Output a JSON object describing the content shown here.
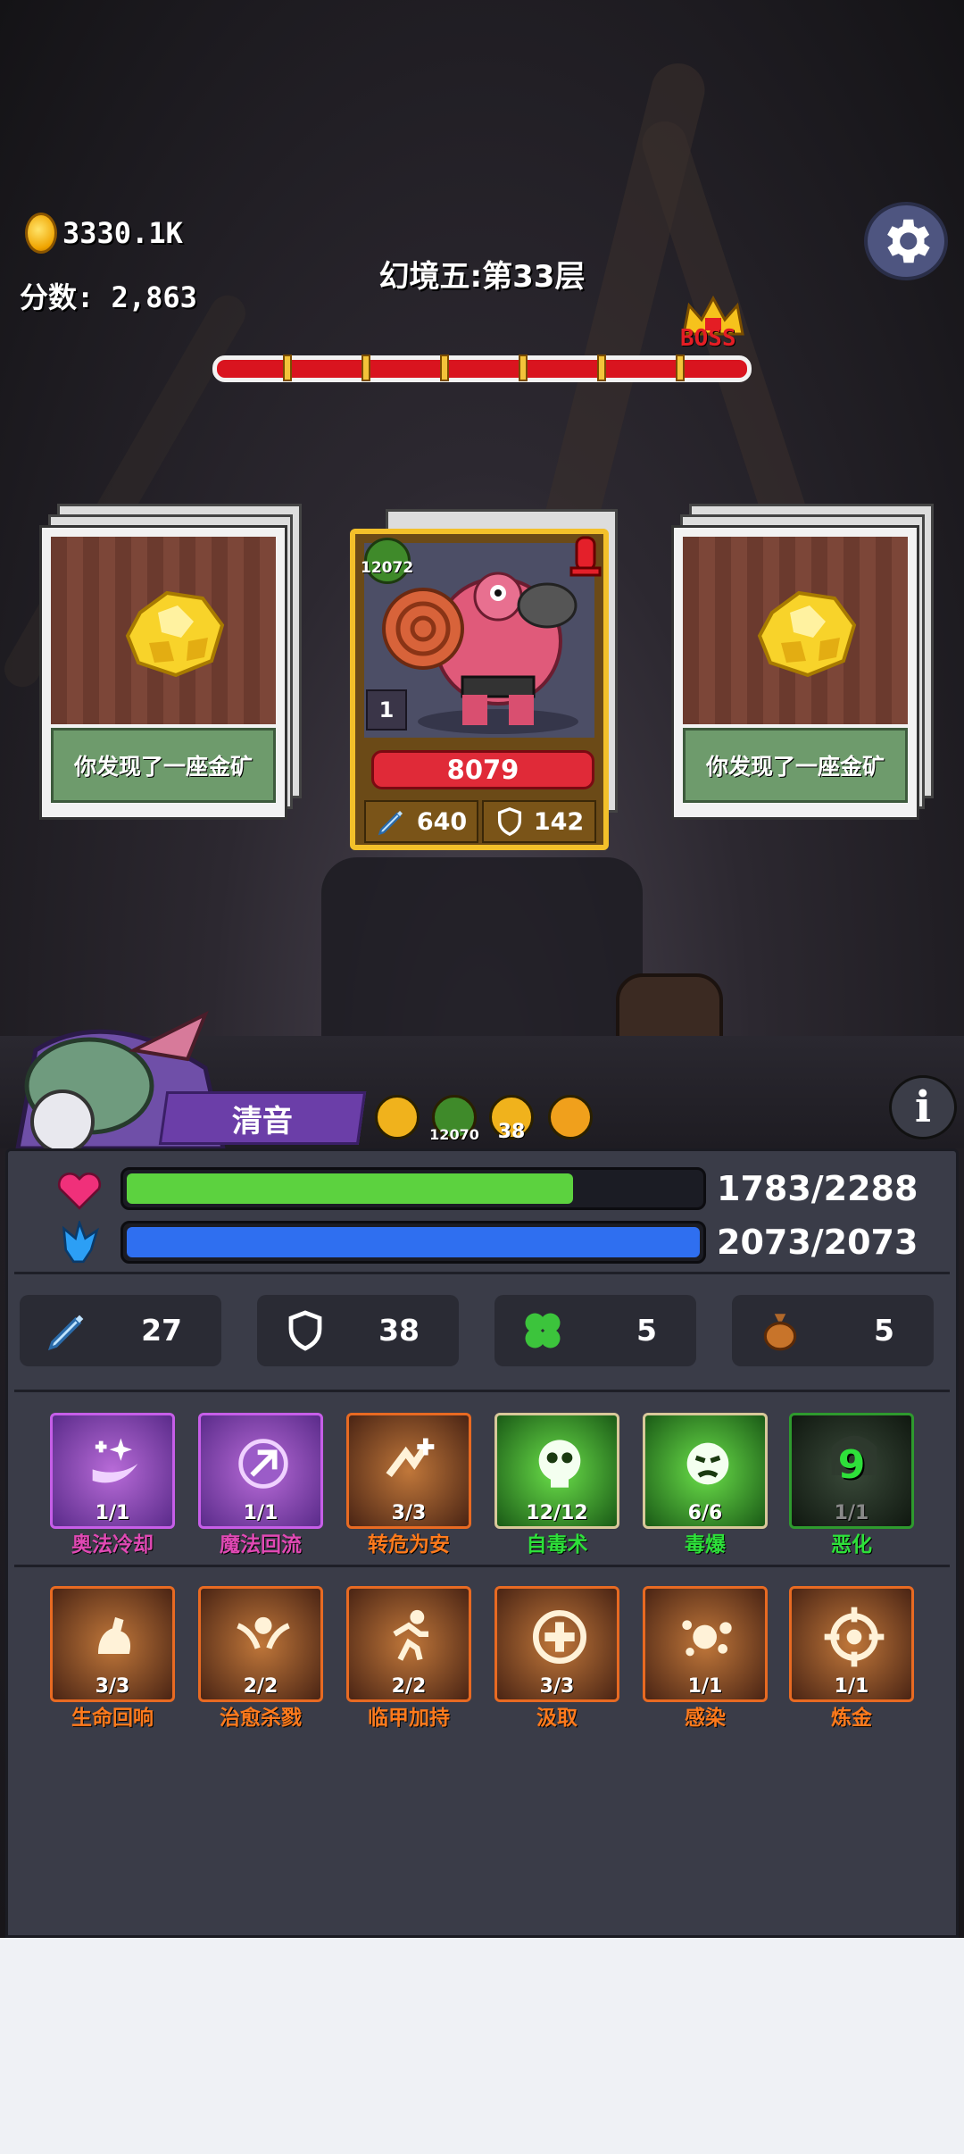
{
  "hud": {
    "coins": "3330.1K",
    "score_label": "分数: 2,863",
    "stage_title": "幻境五:第33层",
    "boss_label": "BOSS"
  },
  "cards": {
    "left": {
      "caption": "你发现了一座金矿"
    },
    "right": {
      "caption": "你发现了一座金矿"
    }
  },
  "enemy": {
    "badge_value": "12072",
    "level": "1",
    "hp": "8079",
    "attack": "640",
    "defense": "142"
  },
  "player": {
    "name": "清音",
    "buffs": [
      {
        "icon": "person-buff-icon",
        "value": ""
      },
      {
        "icon": "poison-buff-icon",
        "value": "12070"
      },
      {
        "icon": "shield-buff-icon",
        "value": "38"
      },
      {
        "icon": "fist-buff-icon",
        "value": ""
      }
    ],
    "hp_text": "1783/2288",
    "hp_fraction": 0.779,
    "mp_text": "2073/2073",
    "mp_fraction": 1.0,
    "stats": {
      "attack": "27",
      "defense": "38",
      "luck": "5",
      "gold_bag": "5"
    }
  },
  "skills_row1": [
    {
      "name": "奥法冷却",
      "level": "1/1",
      "icon": "purple-magic-icon"
    },
    {
      "name": "魔法回流",
      "level": "1/1",
      "icon": "purple-flow-icon"
    },
    {
      "name": "转危为安",
      "level": "3/3",
      "icon": "orange-heal-icon"
    },
    {
      "name": "自毒术",
      "level": "12/12",
      "icon": "green-skull-icon"
    },
    {
      "name": "毒爆",
      "level": "6/6",
      "icon": "green-face-icon"
    },
    {
      "name": "恶化",
      "level": "1/1",
      "icon": "dark-poison-icon",
      "counter": "9"
    }
  ],
  "skills_row2": [
    {
      "name": "生命回响",
      "level": "3/3",
      "icon": "orange-arm-icon"
    },
    {
      "name": "治愈杀戮",
      "level": "2/2",
      "icon": "orange-angel-icon"
    },
    {
      "name": "临甲加持",
      "level": "2/2",
      "icon": "orange-runner-icon"
    },
    {
      "name": "汲取",
      "level": "3/3",
      "icon": "orange-cross-icon"
    },
    {
      "name": "感染",
      "level": "1/1",
      "icon": "orange-splash-icon"
    },
    {
      "name": "炼金",
      "level": "1/1",
      "icon": "orange-target-icon"
    }
  ],
  "colors": {
    "hp_bar": "#5cd23f",
    "mp_bar": "#2f6ff0",
    "purple_skill_name": "#e049b4",
    "orange_skill_name": "#ff7a1c",
    "green_skill_name": "#2ee03a"
  }
}
